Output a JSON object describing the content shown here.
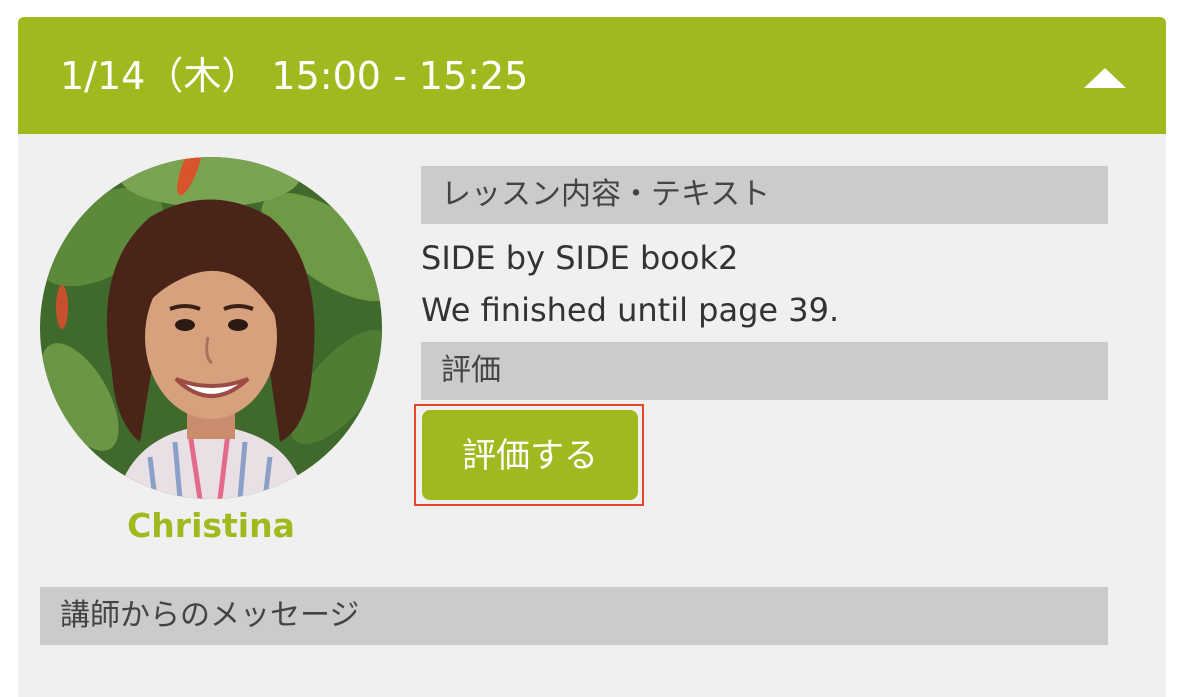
{
  "lesson": {
    "datetime": "1/14（木） 15:00 - 15:25",
    "collapse_icon": "triangle-up-icon",
    "teacher_name": "Christina",
    "content_label": "レッスン内容・テキスト",
    "content_lines": [
      "SIDE by SIDE book2",
      "We finished until page 39."
    ],
    "evaluation_label": "評価",
    "evaluate_button": "評価する",
    "message_label": "講師からのメッセージ"
  },
  "colors": {
    "accent": "#a0b91e",
    "panel_background": "#f0f0f0",
    "label_background": "#cbcbcb",
    "highlight_border": "#e8452c"
  }
}
